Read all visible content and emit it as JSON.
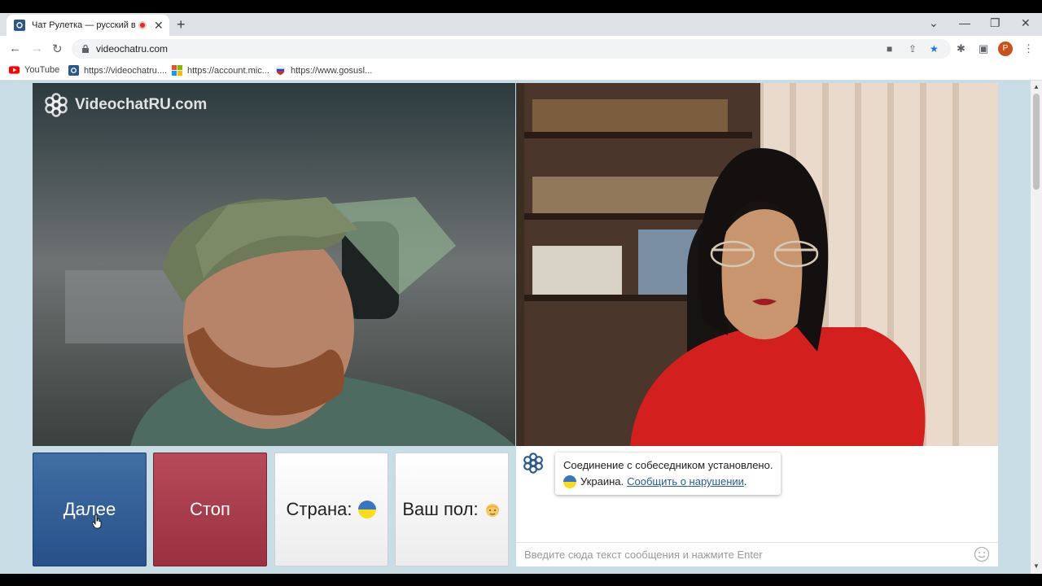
{
  "browser": {
    "tab_title": "Чат Рулетка — русский видео",
    "url": "videochatru.com",
    "bookmarks": [
      "YouTube",
      "https://videochatru....",
      "https://account.mic...",
      "https://www.gosusl..."
    ],
    "profile_initial": "P"
  },
  "page": {
    "logo_text": "VideochatRU.com",
    "buttons": {
      "next": "Далее",
      "stop": "Стоп",
      "country": "Страна:",
      "gender": "Ваш пол:"
    },
    "chat": {
      "status_message": "Соединение с собеседником установлено.",
      "country_name": "Украина.",
      "report_link": "Сообщить о нарушении",
      "report_suffix": ".",
      "input_placeholder": "Введите сюда текст сообщения и нажмите Enter"
    }
  }
}
